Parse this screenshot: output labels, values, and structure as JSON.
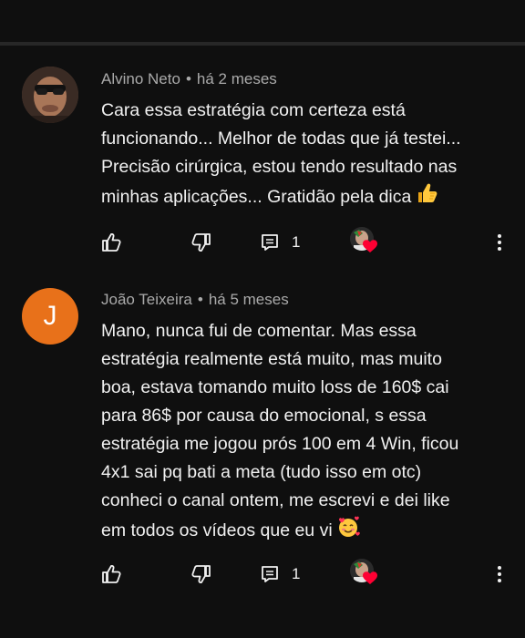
{
  "comments": [
    {
      "author": "Alvino Neto",
      "separator": "•",
      "time": "há 2 meses",
      "avatar_type": "photo",
      "lines": [
        "Cara essa estratégia com certeza está",
        "funcionando... Melhor de todas que já testei...",
        "Precisão cirúrgica, estou tendo resultado nas",
        "minhas aplicações... Gratidão pela dica"
      ],
      "end_emoji": "thumbs-up-emoji",
      "reply_count": "1",
      "icons": {
        "like": "thumb-up-icon",
        "dislike": "thumb-down-icon",
        "replies": "comment-icon",
        "heart": "creator-heart-icon",
        "menu": "more-vert-icon"
      }
    },
    {
      "author": "João Teixeira",
      "separator": "•",
      "time": "há 5 meses",
      "avatar_type": "letter",
      "avatar_letter": "J",
      "avatar_color": "#e8711a",
      "lines": [
        "Mano, nunca fui de comentar. Mas essa",
        "estratégia realmente está muito, mas muito",
        "boa, estava tomando muito loss de 160$ cai",
        "para 86$ por causa do emocional, s essa",
        "estratégia me jogou prós 100 em 4 Win, ficou",
        "4x1 sai pq bati a meta (tudo isso em otc)",
        "conheci o canal ontem, me escrevi e dei like",
        "em todos os vídeos que eu vi"
      ],
      "end_emoji": "smiling-face-with-hearts-emoji",
      "reply_count": "1",
      "icons": {
        "like": "thumb-up-icon",
        "dislike": "thumb-down-icon",
        "replies": "comment-icon",
        "heart": "creator-heart-icon",
        "menu": "more-vert-icon"
      }
    }
  ],
  "colors": {
    "background": "#0f0f0f",
    "divider": "#272727",
    "meta_text": "#aaaaaa",
    "body_text": "#f1f1f1",
    "heart": "#ff0033",
    "avatar_letter_bg": "#e8711a"
  }
}
